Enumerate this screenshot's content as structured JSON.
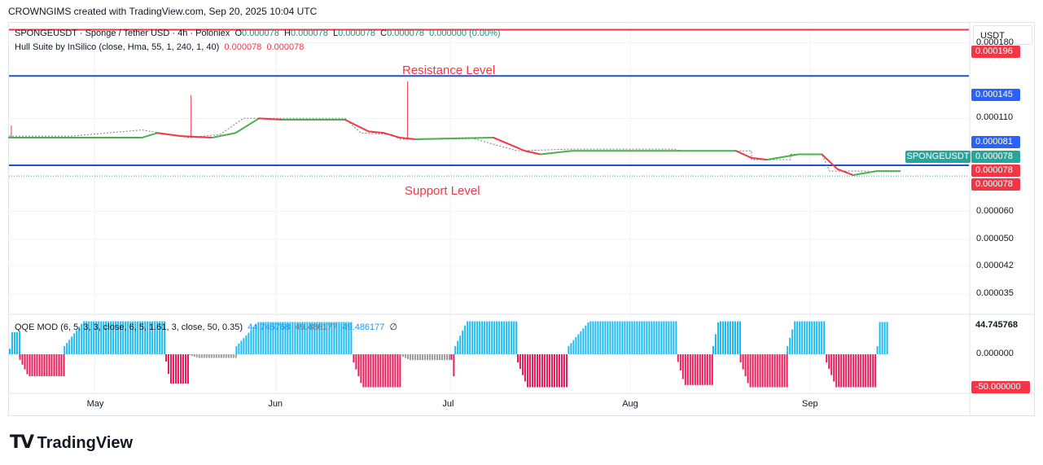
{
  "header": {
    "credit": "CROWNGIMS created with TradingView.com, Sep 20, 2025 10:04 UTC"
  },
  "legend": {
    "symbol": "SPONGEUSDT · Sponge / Tether USD · 4h · Poloniex",
    "o_label": "O",
    "o": "0.000078",
    "h_label": "H",
    "h": "0.000078",
    "l_label": "L",
    "l": "0.000078",
    "c_label": "C",
    "c": "0.000078",
    "change": "0.000000 (0.00%)",
    "hull": "Hull Suite by InSilico (close, Hma, 55, 1, 240, 1, 40)",
    "hull_v1": "0.000078",
    "hull_v2": "0.000078"
  },
  "qqe_legend": {
    "name": "QQE MOD (6, 5, 3, 3, close, 6, 5, 1.61, 3, close, 50, 0.35)",
    "v1": "44.745768",
    "v2": "49.486177",
    "v3": "49.486177",
    "icon": "∅"
  },
  "currency": "USDT",
  "annotations": {
    "resistance": "Resistance Level",
    "support": "Support Level"
  },
  "pair_badge": "SPONGEUSDT",
  "price_badges": [
    {
      "text": "0.000196",
      "color": "#f23645",
      "y": 0.000196
    },
    {
      "text": "0.000145",
      "color": "#2962ff",
      "y": 0.000145
    },
    {
      "text": "0.000081",
      "color": "#2962ff",
      "y": 8.1e-05
    },
    {
      "text": "0.000078",
      "color": "#26a69a",
      "y": 7.8e-05
    },
    {
      "text": "0.000078",
      "color": "#f23645",
      "y": 7.8e-05
    },
    {
      "text": "0.000078",
      "color": "#f23645",
      "y": 7.8e-05
    }
  ],
  "qqe_badges": [
    {
      "text": "44.745768",
      "color": "#ffffff"
    },
    {
      "text": "-50.000000",
      "color": "#f23645"
    }
  ],
  "brand": "TradingView",
  "chart_data": {
    "type": "line",
    "symbol": "SPONGEUSDT",
    "interval": "4h",
    "x_ticks": [
      "May",
      "Jun",
      "Jul",
      "Aug",
      "Sep"
    ],
    "y_ticks": [
      "0.000180",
      "0.000110",
      "0.000060",
      "0.000050",
      "0.000042",
      "0.000035"
    ],
    "y_scale": "log",
    "ylim": [
      3.1e-05,
      0.000205
    ],
    "horizontal_lines": [
      {
        "name": "Resistance Level",
        "y": 0.000196,
        "color": "#f23645"
      },
      {
        "name": "Resistance Level",
        "y": 0.000145,
        "color": "#1e53c8"
      },
      {
        "name": "Support Level",
        "y": 8.1e-05,
        "color": "#1e53c8"
      }
    ],
    "price_steps": [
      [
        0,
        9.8e-05
      ],
      [
        0.08,
        9.8e-05
      ],
      [
        0.17,
        0.000102
      ],
      [
        0.23,
        9.7e-05
      ],
      [
        0.27,
        9.9e-05
      ],
      [
        0.3,
        0.00011
      ],
      [
        0.43,
        0.00011
      ],
      [
        0.45,
        0.0001
      ],
      [
        0.49,
        9.9e-05
      ],
      [
        0.5,
        9.6e-05
      ],
      [
        0.59,
        9.7e-05
      ],
      [
        0.65,
        8.9e-05
      ],
      [
        0.72,
        9e-05
      ],
      [
        0.85,
        9e-05
      ],
      [
        0.86,
        8.9e-05
      ],
      [
        0.95,
        8.9e-05
      ],
      [
        0.95,
        8.4e-05
      ],
      [
        1.0,
        8.4e-05
      ],
      [
        1.0,
        8.7e-05
      ],
      [
        1.04,
        8.7e-05
      ],
      [
        1.05,
        7.8e-05
      ],
      [
        1.1,
        7.8e-05
      ]
    ],
    "hull_line": [
      [
        0,
        9.7e-05
      ],
      [
        0.08,
        9.7e-05
      ],
      [
        0.17,
        9.7e-05
      ],
      [
        0.19,
        0.0001
      ],
      [
        0.22,
        9.8e-05
      ],
      [
        0.26,
        9.7e-05
      ],
      [
        0.29,
        0.0001
      ],
      [
        0.32,
        0.00011
      ],
      [
        0.35,
        0.000109
      ],
      [
        0.43,
        0.000109
      ],
      [
        0.46,
        0.000101
      ],
      [
        0.48,
        0.0001
      ],
      [
        0.5,
        9.7e-05
      ],
      [
        0.52,
        9.6e-05
      ],
      [
        0.62,
        9.7e-05
      ],
      [
        0.66,
        8.9e-05
      ],
      [
        0.68,
        8.7e-05
      ],
      [
        0.72,
        8.9e-05
      ],
      [
        0.86,
        8.9e-05
      ],
      [
        0.93,
        8.9e-05
      ],
      [
        0.95,
        8.5e-05
      ],
      [
        0.97,
        8.4e-05
      ],
      [
        1.01,
        8.7e-05
      ],
      [
        1.04,
        8.7e-05
      ],
      [
        1.06,
        7.9e-05
      ],
      [
        1.08,
        7.6e-05
      ],
      [
        1.11,
        7.8e-05
      ],
      [
        1.14,
        7.8e-05
      ]
    ],
    "spikes": [
      {
        "x": 0.003,
        "high": 0.000105
      },
      {
        "x": 0.233,
        "high": 0.000128
      },
      {
        "x": 0.51,
        "high": 0.00014
      }
    ],
    "qqe_hist": [
      [
        0.0,
        30,
        "up"
      ],
      [
        0.013,
        -30,
        "dn"
      ],
      [
        0.07,
        45,
        "up"
      ],
      [
        0.2,
        -40,
        "dn"
      ],
      [
        0.23,
        -5,
        "gray"
      ],
      [
        0.29,
        44,
        "up"
      ],
      [
        0.44,
        -45,
        "dn"
      ],
      [
        0.5,
        -8,
        "gray"
      ],
      [
        0.565,
        -30,
        "dn"
      ],
      [
        0.57,
        45,
        "up"
      ],
      [
        0.65,
        -45,
        "dn"
      ],
      [
        0.715,
        45,
        "up"
      ],
      [
        0.855,
        -42,
        "dn"
      ],
      [
        0.9,
        45,
        "up"
      ],
      [
        0.935,
        -45,
        "dn"
      ],
      [
        0.995,
        45,
        "up"
      ],
      [
        1.045,
        -45,
        "dn"
      ],
      [
        1.11,
        44,
        "up"
      ],
      [
        1.125,
        null,
        "end"
      ]
    ]
  }
}
